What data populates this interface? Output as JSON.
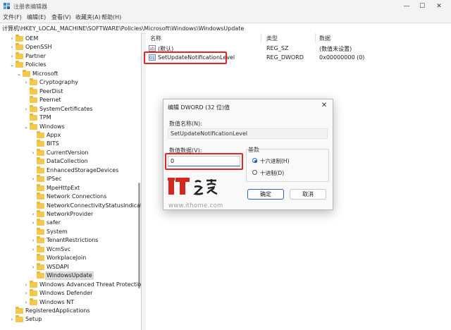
{
  "window": {
    "title": "注册表编辑器",
    "controls": [
      "—",
      "☐",
      "✕"
    ]
  },
  "menu": [
    "文件(F)",
    "编辑(E)",
    "查看(V)",
    "收藏夹(A)",
    "帮助(H)"
  ],
  "address": "计算机\\HKEY_LOCAL_MACHINE\\SOFTWARE\\Policies\\Microsoft\\Windows\\WindowsUpdate",
  "tree": [
    {
      "label": "OEM",
      "chev": "›"
    },
    {
      "label": "OpenSSH",
      "chev": "›"
    },
    {
      "label": "Partner",
      "chev": "›"
    },
    {
      "label": "Policies",
      "chev": "⌄"
    },
    {
      "label": "Microsoft",
      "chev": "⌄"
    },
    {
      "label": "Cryptography",
      "chev": "›"
    },
    {
      "label": "PeerDist",
      "chev": ""
    },
    {
      "label": "Peernet",
      "chev": ""
    },
    {
      "label": "SystemCertificates",
      "chev": "›"
    },
    {
      "label": "TPM",
      "chev": ""
    },
    {
      "label": "Windows",
      "chev": "⌄"
    },
    {
      "label": "Appx",
      "chev": ""
    },
    {
      "label": "BITS",
      "chev": ""
    },
    {
      "label": "CurrentVersion",
      "chev": "›"
    },
    {
      "label": "DataCollection",
      "chev": ""
    },
    {
      "label": "EnhancedStorageDevices",
      "chev": ""
    },
    {
      "label": "IPSec",
      "chev": "›"
    },
    {
      "label": "MpeHttpExt",
      "chev": ""
    },
    {
      "label": "Network Connections",
      "chev": ""
    },
    {
      "label": "NetworkConnectivityStatusIndicator",
      "chev": ""
    },
    {
      "label": "NetworkProvider",
      "chev": "›"
    },
    {
      "label": "safer",
      "chev": "›"
    },
    {
      "label": "System",
      "chev": ""
    },
    {
      "label": "TenantRestrictions",
      "chev": "›"
    },
    {
      "label": "WcmSvc",
      "chev": "›"
    },
    {
      "label": "WorkplaceJoin",
      "chev": ""
    },
    {
      "label": "WSDAPI",
      "chev": "›"
    },
    {
      "label": "WindowsUpdate",
      "chev": "",
      "selected": true
    },
    {
      "label": "Windows Advanced Threat Protection",
      "chev": "›"
    },
    {
      "label": "Windows Defender",
      "chev": "›"
    },
    {
      "label": "Windows NT",
      "chev": "›"
    },
    {
      "label": "RegisteredApplications",
      "chev": ""
    },
    {
      "label": "Setup",
      "chev": "›"
    }
  ],
  "columns": {
    "name": "名称",
    "type": "类型",
    "data": "数据"
  },
  "values": [
    {
      "icon": "ab",
      "name": "(默认)",
      "type": "REG_SZ",
      "data": "(数值未设置)"
    },
    {
      "icon": "01",
      "name": "SetUpdateNotificationLevel",
      "type": "REG_DWORD",
      "data": "0x00000000 (0)"
    }
  ],
  "dialog": {
    "title": "编辑 DWORD (32 位)值",
    "close": "✕",
    "name_label": "数值名称(N):",
    "name_value": "SetUpdateNotificationLevel",
    "data_label": "数值数据(V):",
    "data_value": "0",
    "base_label": "基数",
    "hex_label": "十六进制(H)",
    "dec_label": "十进制(D)",
    "base_selected": "hex",
    "ok": "确定",
    "cancel": "取消"
  },
  "watermark": {
    "logo_text": "IT之家",
    "url": "www.ithome.com"
  },
  "colors": {
    "highlight": "#e3252c",
    "folder": "#f2c94c",
    "accent": "#2a62c9"
  }
}
